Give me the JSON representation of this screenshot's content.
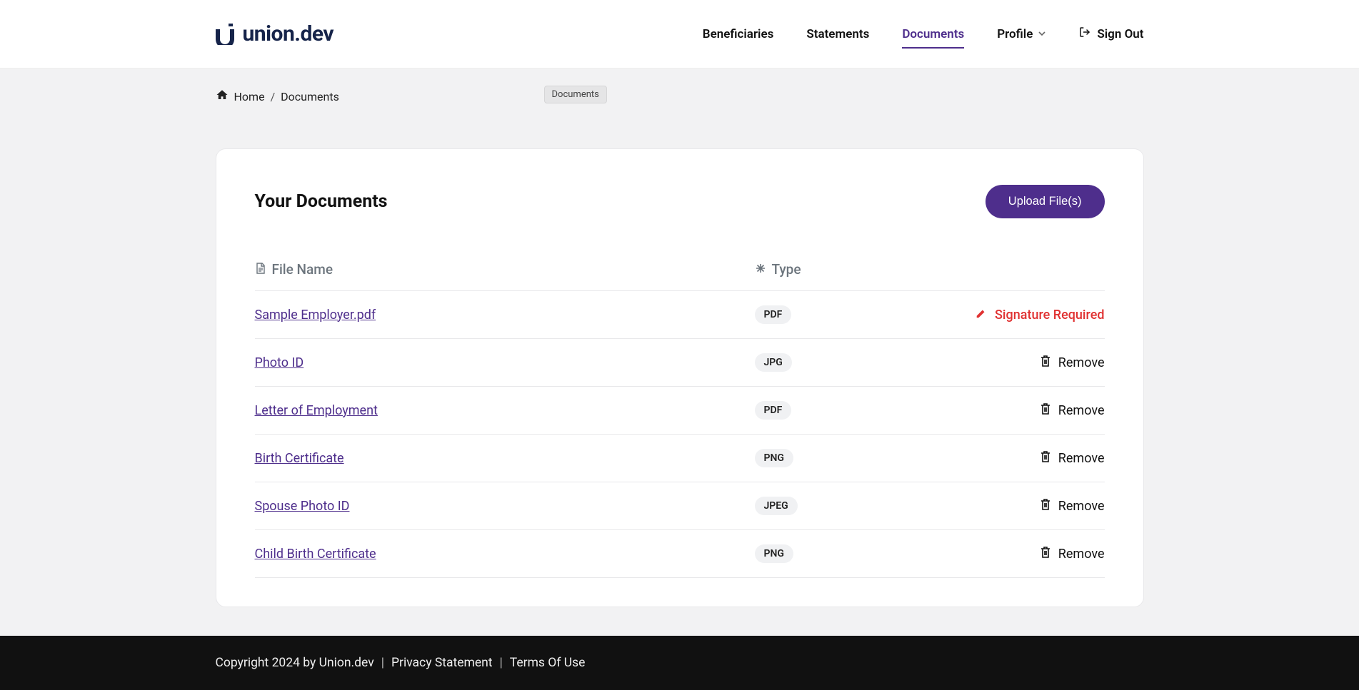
{
  "brand": {
    "name": "union.dev"
  },
  "nav": {
    "items": [
      {
        "label": "Beneficiaries",
        "active": false
      },
      {
        "label": "Statements",
        "active": false
      },
      {
        "label": "Documents",
        "active": true
      },
      {
        "label": "Profile",
        "active": false,
        "caret": true
      }
    ],
    "signout_label": "Sign Out"
  },
  "breadcrumb": {
    "home_label": "Home",
    "current_label": "Documents"
  },
  "tooltip_badge": "Documents",
  "card": {
    "title": "Your Documents",
    "upload_label": "Upload File(s)",
    "col_file_label": "File Name",
    "col_type_label": "Type",
    "signature_required_label": "Signature Required",
    "remove_label": "Remove"
  },
  "documents": [
    {
      "name": "Sample Employer.pdf",
      "type": "PDF",
      "signature_required": true
    },
    {
      "name": "Photo ID",
      "type": "JPG",
      "signature_required": false
    },
    {
      "name": "Letter of Employment",
      "type": "PDF",
      "signature_required": false
    },
    {
      "name": "Birth Certificate",
      "type": "PNG",
      "signature_required": false
    },
    {
      "name": "Spouse Photo ID",
      "type": "JPEG",
      "signature_required": false
    },
    {
      "name": "Child Birth Certificate",
      "type": "PNG",
      "signature_required": false
    }
  ],
  "footer": {
    "copyright": "Copyright 2024 by Union.dev ",
    "privacy_label": "Privacy Statement",
    "terms_label": "Terms Of Use"
  }
}
